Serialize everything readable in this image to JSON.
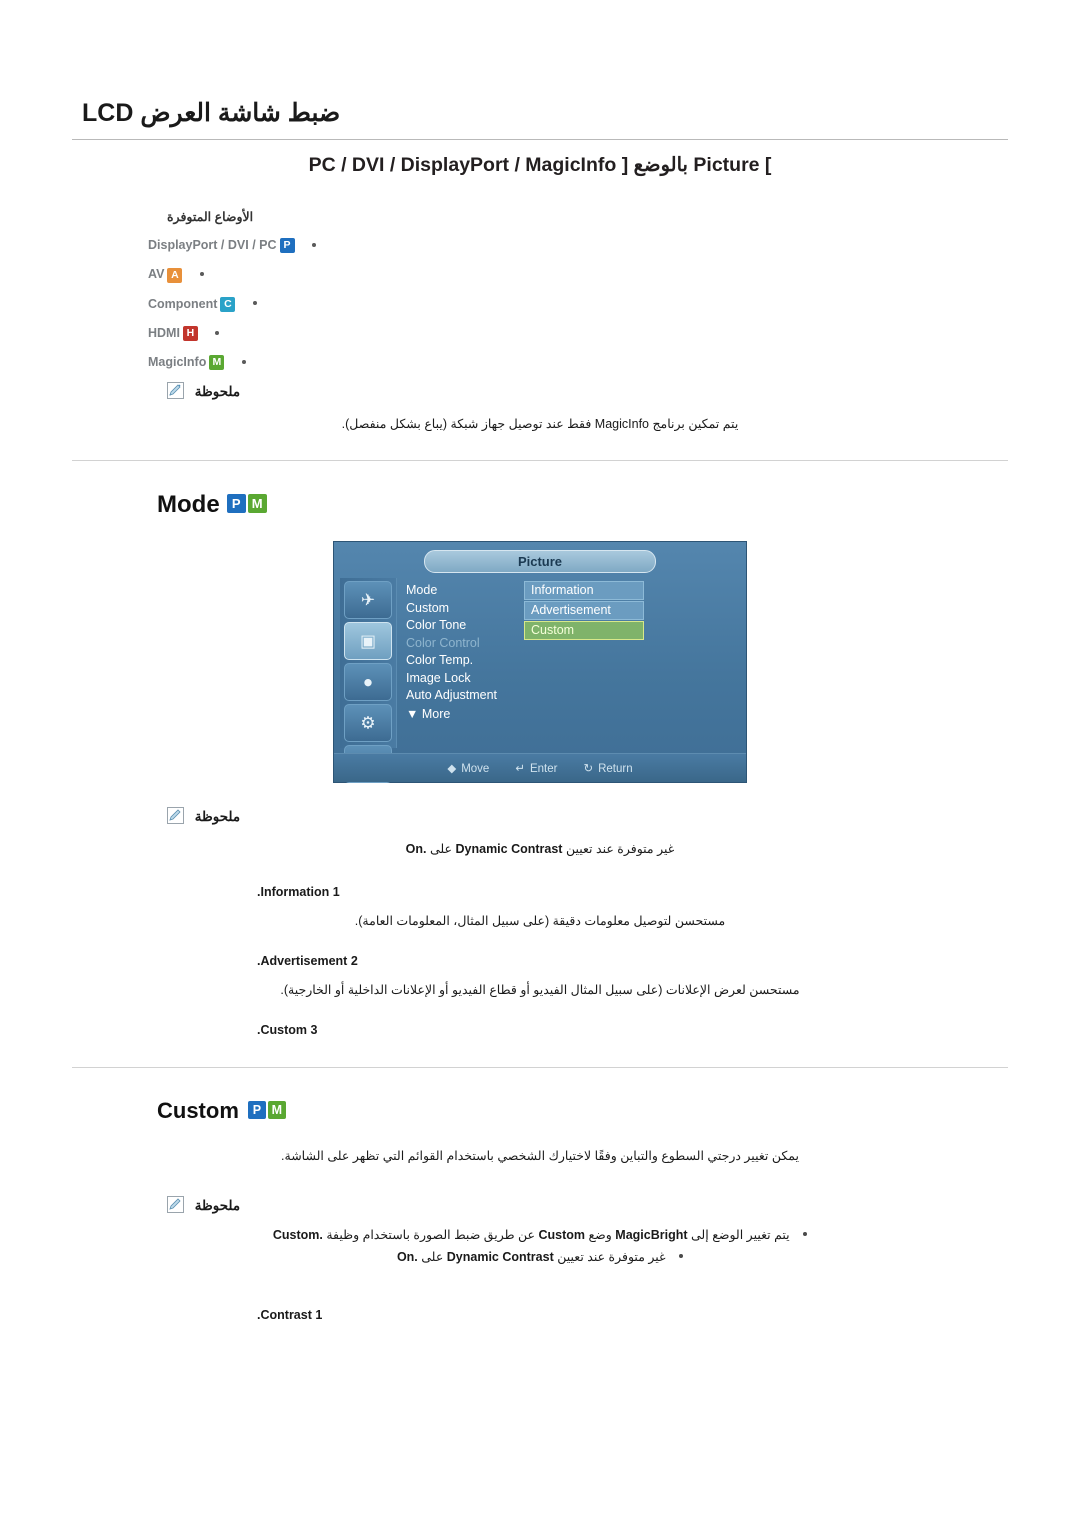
{
  "header": {
    "title": "ضبط شاشة العرض LCD",
    "subtitle_prefix": "Picture [",
    "subtitle_arabic": "بالوضع",
    "subtitle_modes": "PC / DVI / DisplayPort / MagicInfo",
    "subtitle_suffix": "]"
  },
  "available": {
    "heading": "الأوضاع المتوفرة",
    "items": [
      {
        "label": "DisplayPort / DVI / PC",
        "badge": "P",
        "badge_class": "p"
      },
      {
        "label": "AV",
        "badge": "A",
        "badge_class": "a"
      },
      {
        "label": "Component",
        "badge": "C",
        "badge_class": "c"
      },
      {
        "label": "HDMI",
        "badge": "H",
        "badge_class": "h"
      },
      {
        "label": "MagicInfo",
        "badge": "M",
        "badge_class": "m"
      }
    ]
  },
  "note1": {
    "heading": "ملحوظة",
    "body": "يتم تمكين برنامج MagicInfo فقط عند توصيل جهاز شبكة (يباع بشكل منفصل)."
  },
  "mode_section": {
    "badge_m": "M",
    "badge_p": "P",
    "heading": "Mode"
  },
  "osd": {
    "title": "Picture",
    "menu": [
      {
        "label": "Mode",
        "dim": false
      },
      {
        "label": "Custom",
        "dim": false
      },
      {
        "label": "Color Tone",
        "dim": false
      },
      {
        "label": "Color Control",
        "dim": true
      },
      {
        "label": "Color Temp.",
        "dim": false
      },
      {
        "label": "Image Lock",
        "dim": false
      },
      {
        "label": "Auto Adjustment",
        "dim": false
      }
    ],
    "more": "More",
    "values": [
      {
        "label": "Information",
        "highlight": false
      },
      {
        "label": "Advertisement",
        "highlight": false
      },
      {
        "label": "Custom",
        "highlight": true
      }
    ],
    "footer": [
      {
        "key": "Move"
      },
      {
        "key": "Enter"
      },
      {
        "key": "Return"
      }
    ],
    "icons": [
      "picture-quality-icon",
      "picture-icon",
      "sound-icon",
      "setup-icon",
      "multi-control-icon"
    ]
  },
  "note2": {
    "heading": "ملحوظة",
    "body_ar_1": "غير متوفرة عند تعيين",
    "body_en": "Dynamic Contrast",
    "body_ar_2": "على",
    "body_en2": "On."
  },
  "mode_items": [
    {
      "num": "1.",
      "title": "Information",
      "desc": "مستحسن لتوصيل معلومات دقيقة (على سبيل المثال، المعلومات العامة)."
    },
    {
      "num": "2.",
      "title": "Advertisement",
      "desc": "مستحسن لعرض الإعلانات (على سبيل المثال الفيديو أو قطاع الفيديو أو الإعلانات الداخلية أو الخارجية)."
    },
    {
      "num": "3.",
      "title": "Custom",
      "desc": ""
    }
  ],
  "custom_section": {
    "badge_m": "M",
    "badge_p": "P",
    "heading": "Custom",
    "paragraph": "يمكن تغيير درجتي السطوع والتباين وفقًا لاختيارك الشخصي باستخدام القوائم التي تظهر على الشاشة."
  },
  "note3": {
    "heading": "ملحوظة",
    "bullets": [
      {
        "ar_start": "يتم تغيير الوضع إلى",
        "en1": "MagicBright",
        "ar_mid": "وضع",
        "en2": "Custom",
        "ar_end": "عن طريق ضبط الصورة باستخدام وظيفة",
        "en3": "Custom."
      },
      {
        "ar_start": "غير متوفرة عند تعيين",
        "en1": "Dynamic Contrast",
        "ar_mid": "على",
        "en2": "On."
      }
    ]
  },
  "contrast_item": {
    "num": "1.",
    "title": "Contrast"
  }
}
